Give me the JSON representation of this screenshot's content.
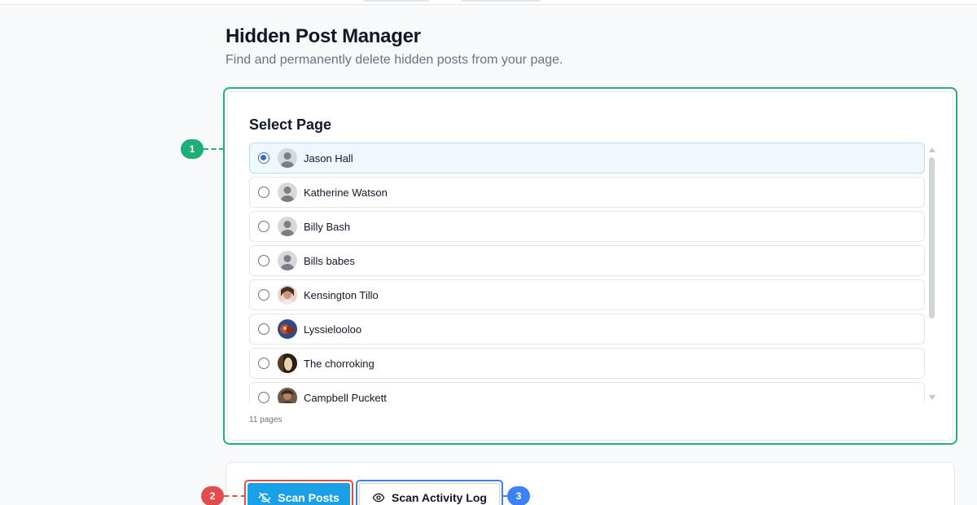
{
  "header": {
    "title": "Hidden Post Manager",
    "subtitle": "Find and permanently delete hidden posts from your page."
  },
  "select_page": {
    "title": "Select Page",
    "count_label": "11 pages",
    "selected": "Jason Hall",
    "items": [
      {
        "name": "Jason Hall",
        "avatar": "default-avatar-icon",
        "selected": true
      },
      {
        "name": "Katherine Watson",
        "avatar": "default-avatar-icon",
        "selected": false
      },
      {
        "name": "Billy Bash",
        "avatar": "default-avatar-icon",
        "selected": false
      },
      {
        "name": "Bills babes",
        "avatar": "default-avatar-icon",
        "selected": false
      },
      {
        "name": "Kensington Tillo",
        "avatar": "photo-avatar",
        "selected": false
      },
      {
        "name": "Lyssielooloo",
        "avatar": "photo-avatar",
        "selected": false
      },
      {
        "name": "The chorroking",
        "avatar": "photo-avatar",
        "selected": false
      },
      {
        "name": "Campbell Puckett",
        "avatar": "photo-avatar",
        "selected": false
      }
    ]
  },
  "actions": {
    "scan_posts_label": "Scan Posts",
    "scan_posts_icon": "eye-off-icon",
    "scan_activity_label": "Scan Activity Log",
    "scan_activity_icon": "eye-icon"
  },
  "markers": [
    "1",
    "2",
    "3"
  ],
  "colors": {
    "accent_green": "#22b07d",
    "marker_red": "#e24c4c",
    "marker_blue": "#3b82f6",
    "primary_button": "#1aa0e6",
    "selected_row": "#f0f8ff"
  }
}
